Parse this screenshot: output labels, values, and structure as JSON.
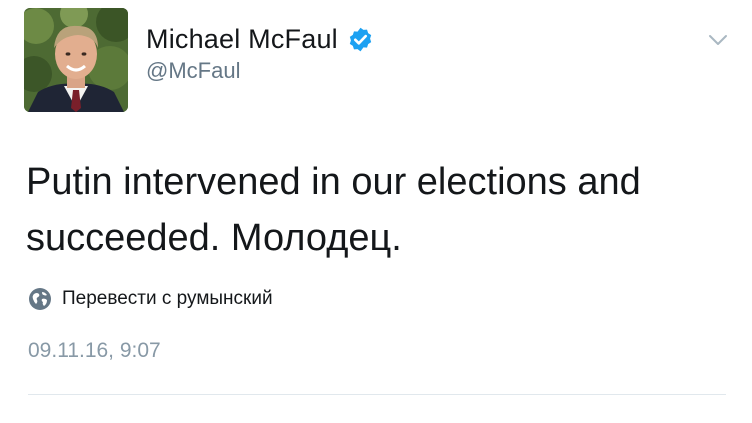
{
  "author": {
    "display_name": "Michael McFaul",
    "handle": "@McFaul",
    "verified": true
  },
  "icons": {
    "verified": "verified-badge-icon",
    "menu": "chevron-down-icon",
    "translate": "globe-icon"
  },
  "tweet": {
    "text_line_1": "Putin intervened in our elections and",
    "text_line_2": "succeeded. Молодец.",
    "translate_label": "Перевести с румынский",
    "timestamp": "09.11.16, 9:07"
  },
  "colors": {
    "verified_blue": "#1da1f2",
    "secondary_text": "#657786",
    "timestamp_text": "#8899a6",
    "divider": "#e1e8ed"
  }
}
